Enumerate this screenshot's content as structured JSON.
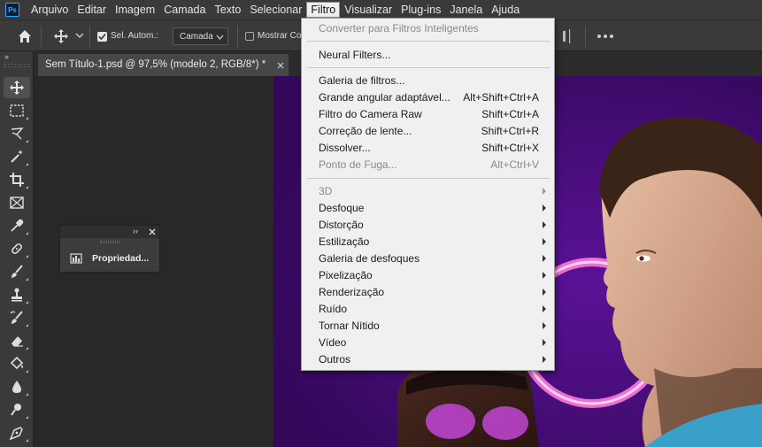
{
  "app": {
    "logo": "Ps",
    "menus": [
      "Arquivo",
      "Editar",
      "Imagem",
      "Camada",
      "Texto",
      "Selecionar",
      "Filtro",
      "Visualizar",
      "Plug-ins",
      "Janela",
      "Ajuda"
    ],
    "active_menu": "Filtro"
  },
  "options_bar": {
    "home_icon": "home-icon",
    "move_icon": "move-tool-icon",
    "auto_select_label": "Sel. Autom.:",
    "auto_select_checked": true,
    "auto_select_target": "Camada",
    "show_controls_label": "Mostrar Co",
    "show_controls_checked": false
  },
  "tab": {
    "title": "Sem Título-1.psd @ 97,5% (modelo 2, RGB/8*) *"
  },
  "toolbar": {
    "collapse_label": "››",
    "tools": [
      {
        "icon": "move-icon",
        "selected": true
      },
      {
        "icon": "marquee-icon"
      },
      {
        "icon": "lasso-icon"
      },
      {
        "icon": "magic-wand-icon"
      },
      {
        "icon": "crop-icon"
      },
      {
        "icon": "frame-icon"
      },
      {
        "icon": "eyedropper-icon"
      },
      {
        "icon": "healing-brush-icon"
      },
      {
        "icon": "brush-icon"
      },
      {
        "icon": "clone-stamp-icon"
      },
      {
        "icon": "history-brush-icon"
      },
      {
        "icon": "eraser-icon"
      },
      {
        "icon": "paint-bucket-icon"
      },
      {
        "icon": "blur-icon"
      },
      {
        "icon": "dodge-icon"
      },
      {
        "icon": "pen-icon"
      }
    ]
  },
  "properties_panel": {
    "expand_label": "››",
    "label": "Propriedad..."
  },
  "filter_menu": {
    "group1": [
      {
        "label": "Converter para Filtros Inteligentes",
        "disabled": true
      }
    ],
    "group2": [
      {
        "label": "Neural Filters..."
      }
    ],
    "group3": [
      {
        "label": "Galeria de filtros...",
        "shortcut": ""
      },
      {
        "label": "Grande angular adaptável...",
        "shortcut": "Alt+Shift+Ctrl+A"
      },
      {
        "label": "Filtro do Camera Raw",
        "shortcut": "Shift+Ctrl+A"
      },
      {
        "label": "Correção de lente...",
        "shortcut": "Shift+Ctrl+R"
      },
      {
        "label": "Dissolver...",
        "shortcut": "Shift+Ctrl+X"
      },
      {
        "label": "Ponto de Fuga...",
        "shortcut": "Alt+Ctrl+V",
        "disabled": true
      }
    ],
    "group4": [
      {
        "label": "3D",
        "disabled": true
      },
      {
        "label": "Desfoque"
      },
      {
        "label": "Distorção"
      },
      {
        "label": "Estilização"
      },
      {
        "label": "Galeria de desfoques"
      },
      {
        "label": "Pixelização"
      },
      {
        "label": "Renderização"
      },
      {
        "label": "Ruído"
      },
      {
        "label": "Tornar Nítido"
      },
      {
        "label": "Vídeo"
      },
      {
        "label": "Outros"
      }
    ]
  },
  "colors": {
    "chrome": "#3a3a3a",
    "artwork_bg": "#3e0a66",
    "menu_bg": "#f0f0f0"
  }
}
